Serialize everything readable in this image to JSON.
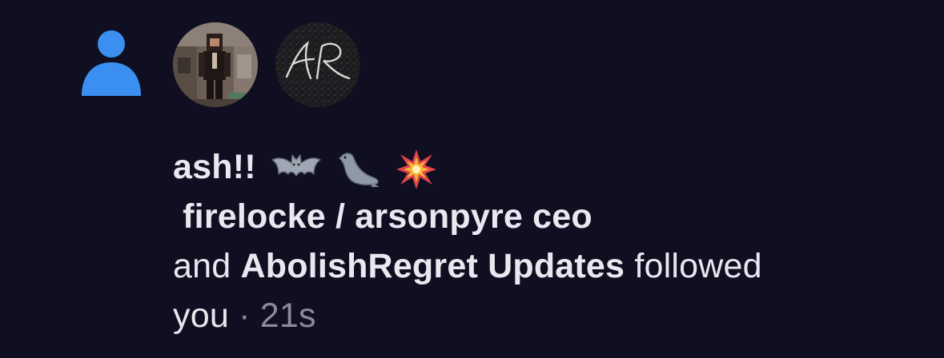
{
  "notification": {
    "icon": "person-icon",
    "accent_color": "#3b8ff0",
    "avatars": [
      {
        "name": "minecraft-skin-avatar"
      },
      {
        "name": "ar-monogram-avatar",
        "text": "AR"
      }
    ],
    "first_user": {
      "name": "ash!!",
      "emojis": [
        "bat-emoji",
        "seal-emoji",
        "collision-emoji"
      ]
    },
    "second_user": {
      "name": "firelocke / arsonpyre ceo"
    },
    "connector": "and",
    "third_user": {
      "name": "AbolishRegret Updates"
    },
    "action": "followed",
    "object": "you",
    "separator": "·",
    "timestamp": "21s"
  }
}
